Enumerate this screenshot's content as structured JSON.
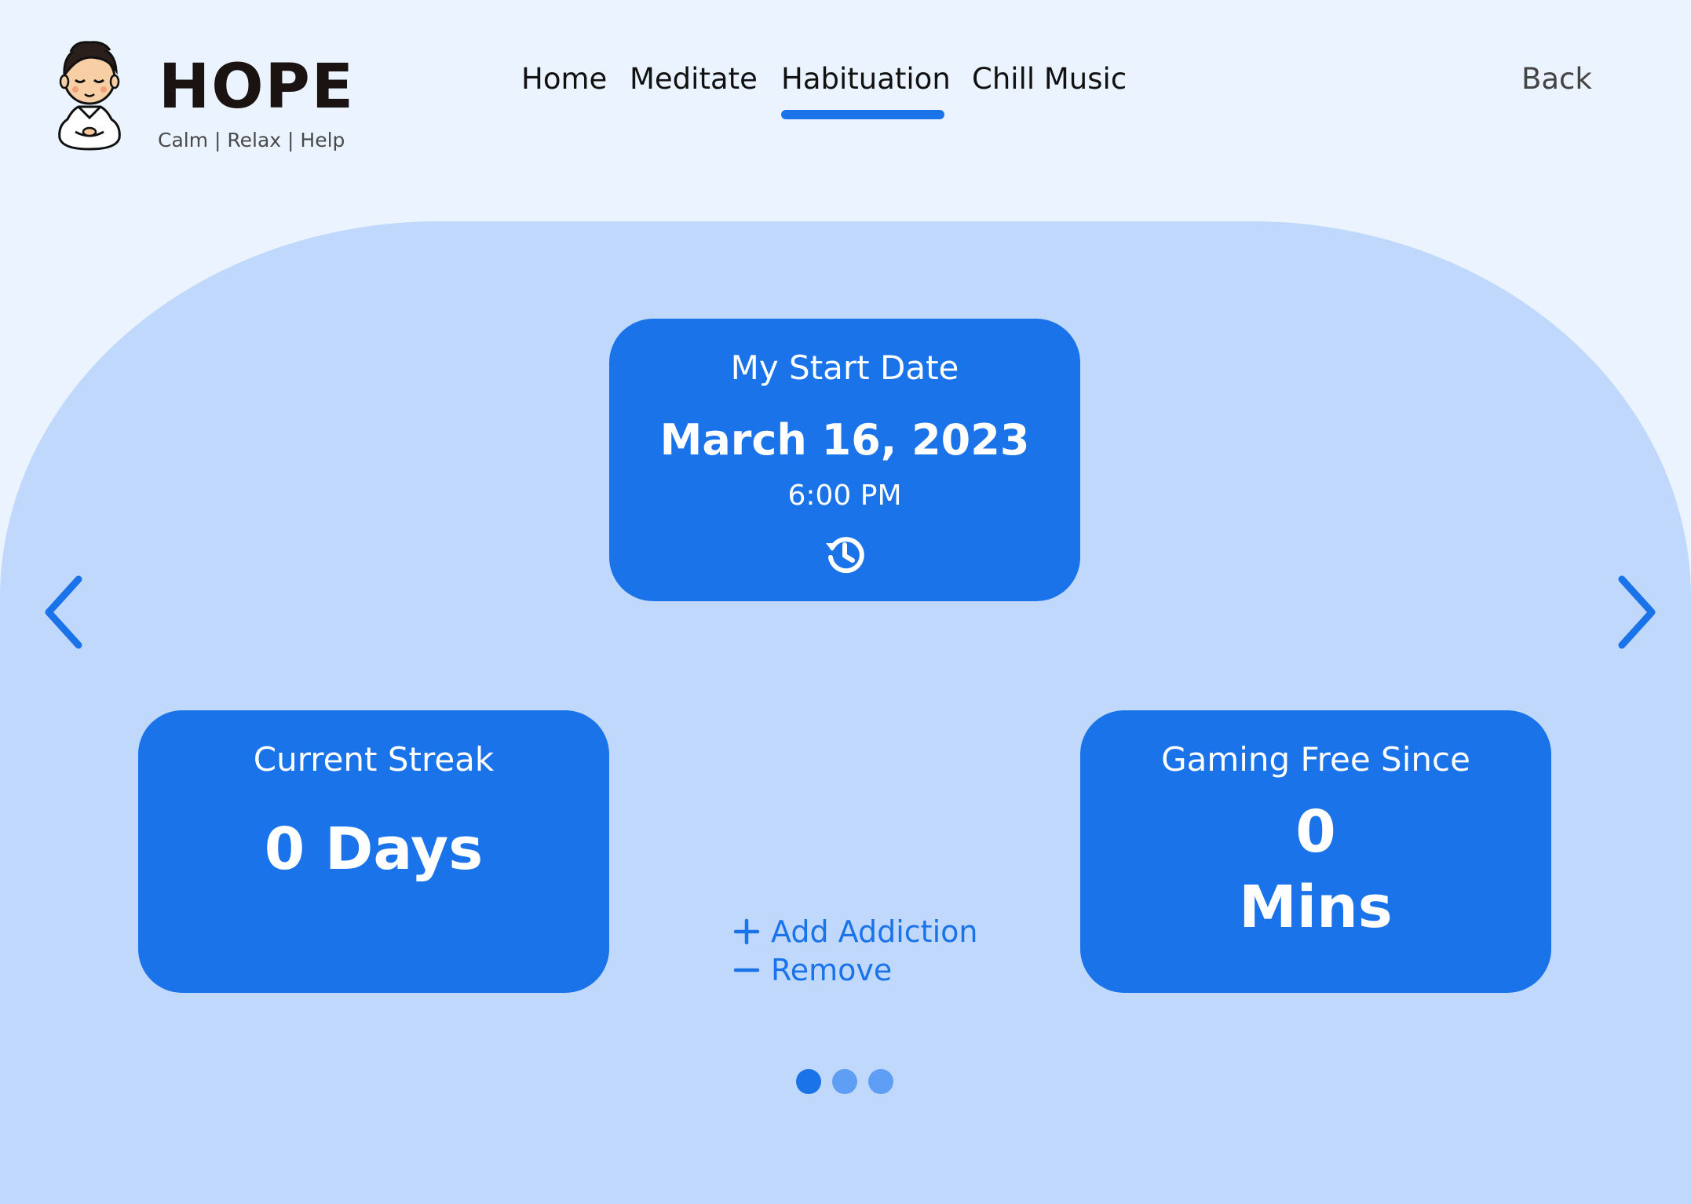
{
  "brand": {
    "title": "HOPE",
    "tagline": "Calm | Relax | Help"
  },
  "nav": {
    "items": [
      {
        "label": "Home",
        "active": false
      },
      {
        "label": "Meditate",
        "active": false
      },
      {
        "label": "Habituation",
        "active": true
      },
      {
        "label": "Chill Music",
        "active": false
      }
    ],
    "back_label": "Back"
  },
  "start_card": {
    "label": "My Start Date",
    "date": "March 16, 2023",
    "time": "6:00 PM",
    "icon": "history-icon"
  },
  "streak_card": {
    "label": "Current Streak",
    "value": "0 Days"
  },
  "gaming_card": {
    "label": "Gaming Free Since",
    "number": "0",
    "unit": "Mins"
  },
  "actions": {
    "add_label": "Add Addiction",
    "remove_label": "Remove"
  },
  "carousel": {
    "pages": 3,
    "active_index": 0
  },
  "colors": {
    "accent": "#1a73e8",
    "background": "#eaf3fe",
    "panel": "#bfd8fc",
    "dot_inactive": "#5e9ef5"
  }
}
